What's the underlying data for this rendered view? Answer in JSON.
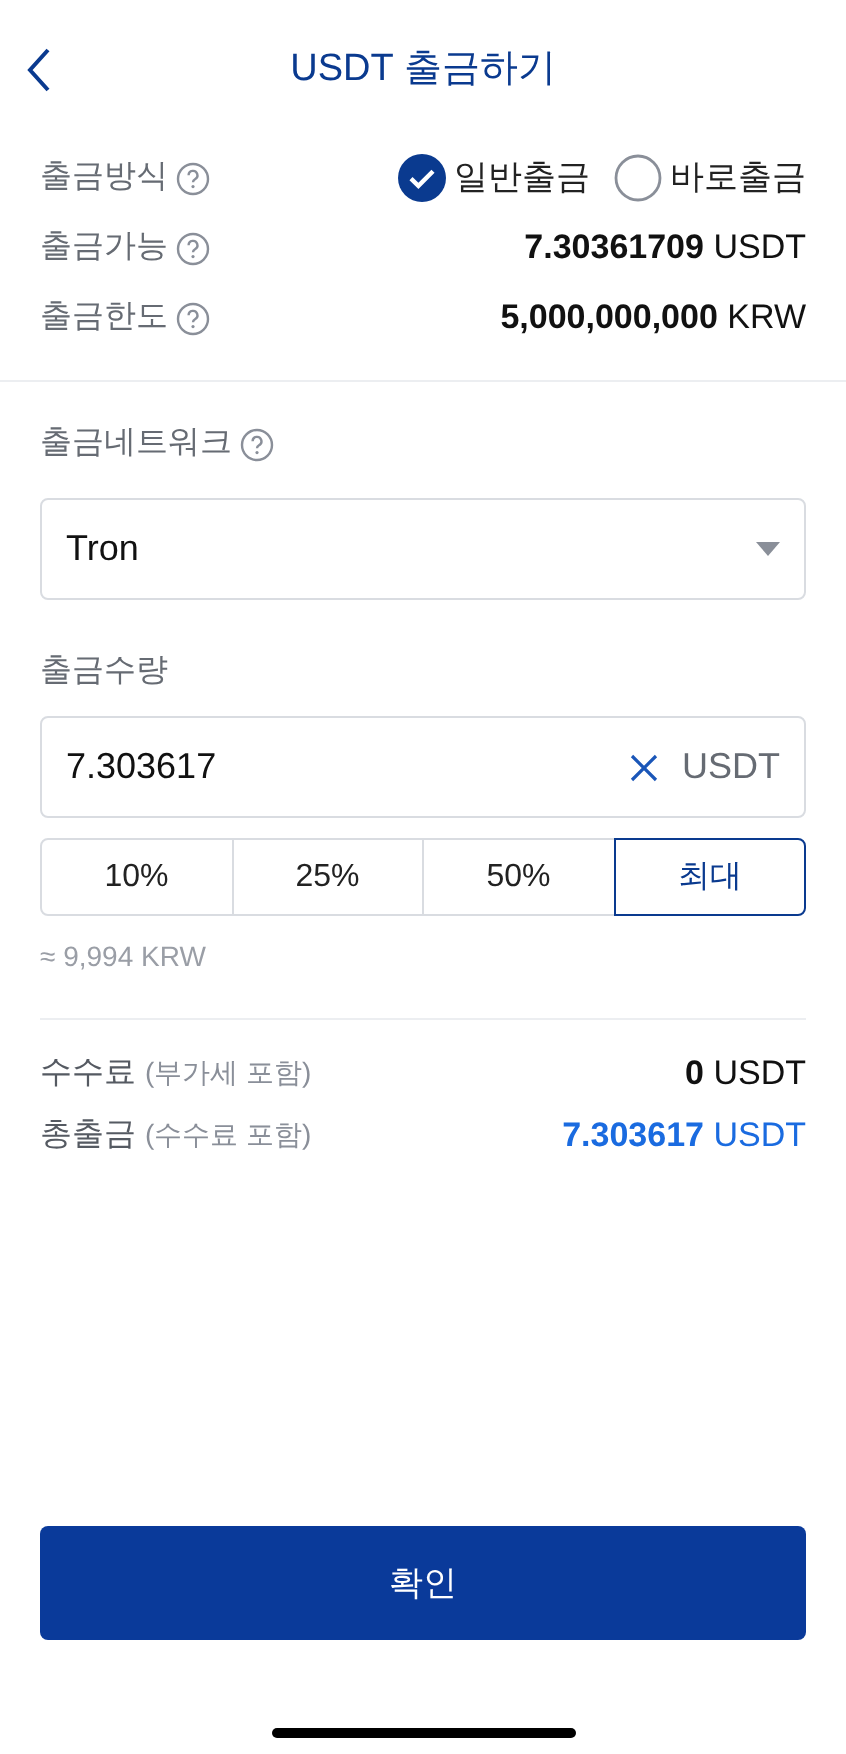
{
  "header": {
    "title": "USDT 출금하기"
  },
  "method": {
    "label": "출금방식",
    "options": [
      {
        "label": "일반출금",
        "selected": true
      },
      {
        "label": "바로출금",
        "selected": false
      }
    ]
  },
  "info_rows": [
    {
      "label": "출금가능",
      "value": "7.30361709",
      "unit": "USDT"
    },
    {
      "label": "출금한도",
      "value": "5,000,000,000",
      "unit": "KRW"
    }
  ],
  "network": {
    "label": "출금네트워크",
    "value": "Tron"
  },
  "amount": {
    "label": "출금수량",
    "value": "7.303617",
    "unit": "USDT"
  },
  "presets": [
    {
      "label": "10%",
      "selected": false
    },
    {
      "label": "25%",
      "selected": false
    },
    {
      "label": "50%",
      "selected": false
    },
    {
      "label": "최대",
      "selected": true
    }
  ],
  "krw_estimate": "≈ 9,994 KRW",
  "summary": [
    {
      "label": "수수료",
      "note": "(부가세 포함)",
      "value": "0",
      "unit": "USDT",
      "highlight": false
    },
    {
      "label": "총출금",
      "note": "(수수료 포함)",
      "value": "7.303617",
      "unit": "USDT",
      "highlight": true
    }
  ],
  "confirm_button": "확인"
}
